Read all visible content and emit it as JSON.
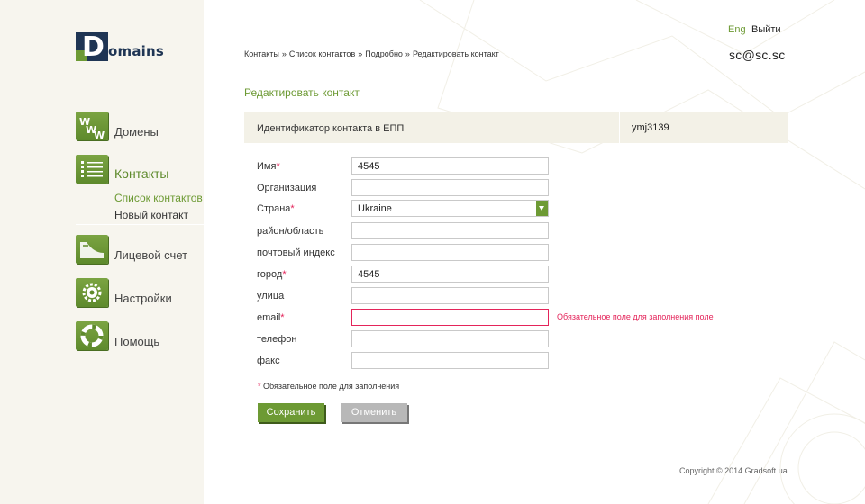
{
  "logo": {
    "letter": "D",
    "text": "omains"
  },
  "nav": {
    "items": [
      {
        "label": "Домены",
        "icon": "www-icon"
      },
      {
        "label": "Контакты",
        "icon": "contacts-list-icon"
      },
      {
        "label": "Лицевой счет",
        "icon": "account-icon"
      },
      {
        "label": "Настройки",
        "icon": "settings-gear-icon"
      },
      {
        "label": "Помощь",
        "icon": "lifebuoy-icon"
      }
    ],
    "sub_items": [
      {
        "label": "Список контактов"
      },
      {
        "label": "Новый контакт"
      }
    ]
  },
  "topbar": {
    "lang": "Eng",
    "logout": "Выйти",
    "user": "sc@sc.sc"
  },
  "breadcrumb": {
    "items": [
      "Контакты",
      "Список контактов",
      "Подробно"
    ],
    "current": "Редактировать контакт",
    "separator": "»"
  },
  "page": {
    "title": "Редактировать контакт"
  },
  "id_bar": {
    "label": "Идентификатор контакта в ЕПП",
    "value": "ymj3139"
  },
  "form": {
    "required_mark": "*",
    "fields": [
      {
        "label": "Имя",
        "required": true,
        "value": "4545"
      },
      {
        "label": "Организация",
        "required": false,
        "value": ""
      },
      {
        "label": "Страна",
        "required": true,
        "value": "Ukraine"
      },
      {
        "label": "район/область",
        "required": false,
        "value": ""
      },
      {
        "label": "почтовый индекс",
        "required": false,
        "value": ""
      },
      {
        "label": "город",
        "required": true,
        "value": "4545"
      },
      {
        "label": "улица",
        "required": false,
        "value": ""
      },
      {
        "label": "email",
        "required": true,
        "value": ""
      },
      {
        "label": "телефон",
        "required": false,
        "value": ""
      },
      {
        "label": "факс",
        "required": false,
        "value": ""
      }
    ],
    "email_error": "Обязательное поле для заполнения поле",
    "required_note": "Обязательное поле для заполнения",
    "save_label": "Сохранить",
    "cancel_label": "Отменить"
  },
  "footer": {
    "copyright": "Copyright ©  2014 Gradsoft.ua"
  },
  "colors": {
    "accent": "#6d9a34",
    "error": "#e4245a",
    "logo_dark": "#1f3554",
    "sidebar_bg": "#f7f5ee"
  }
}
